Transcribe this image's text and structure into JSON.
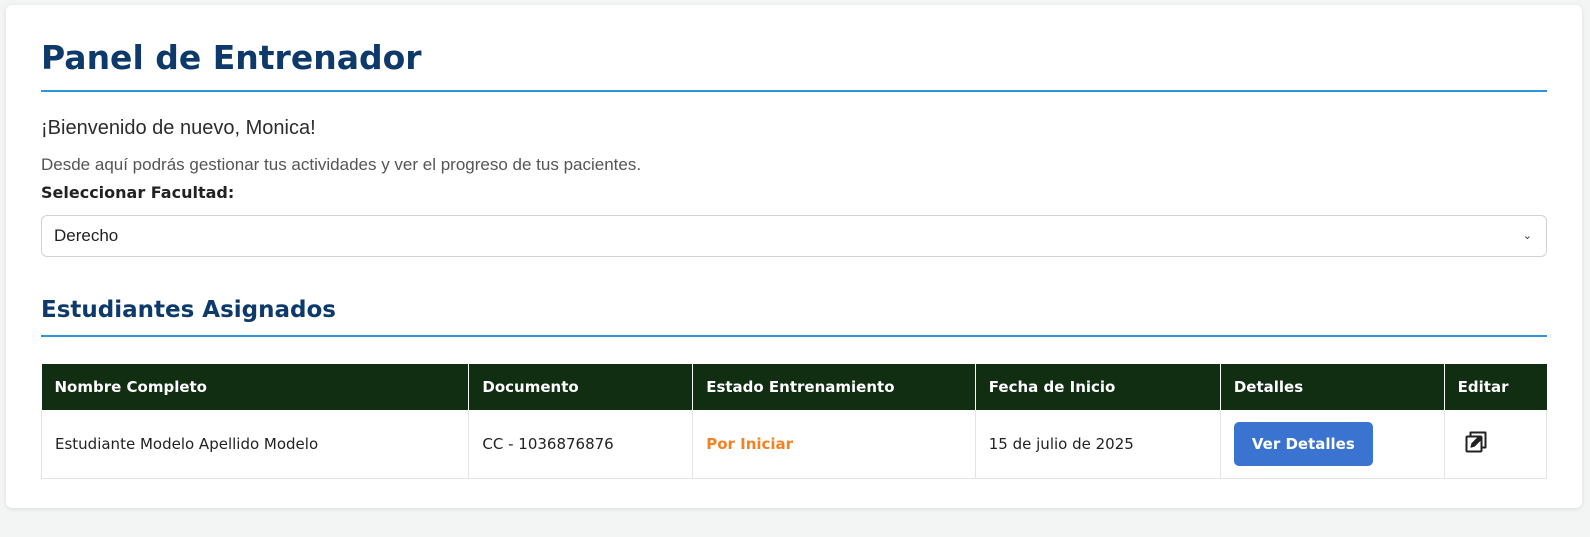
{
  "header": {
    "title": "Panel de Entrenador"
  },
  "welcome": {
    "greeting": "¡Bienvenido de nuevo, Monica!",
    "description": "Desde aquí podrás gestionar tus actividades y ver el progreso de tus pacientes."
  },
  "faculty": {
    "label": "Seleccionar Facultad:",
    "selected": "Derecho"
  },
  "students_section": {
    "title": "Estudiantes Asignados",
    "columns": [
      "Nombre Completo",
      "Documento",
      "Estado Entrenamiento",
      "Fecha de Inicio",
      "Detalles",
      "Editar"
    ],
    "rows": [
      {
        "name": "Estudiante Modelo Apellido Modelo",
        "document": "CC - 1036876876",
        "status": "Por Iniciar",
        "start_date": "15 de julio de 2025",
        "details_label": "Ver Detalles",
        "edit_icon": "edit-square-icon"
      }
    ]
  },
  "colors": {
    "title": "#0d3a6b",
    "rule": "#2b95d8",
    "table_header": "#112e13",
    "status_pending": "#f58220",
    "button": "#3a73d0"
  }
}
